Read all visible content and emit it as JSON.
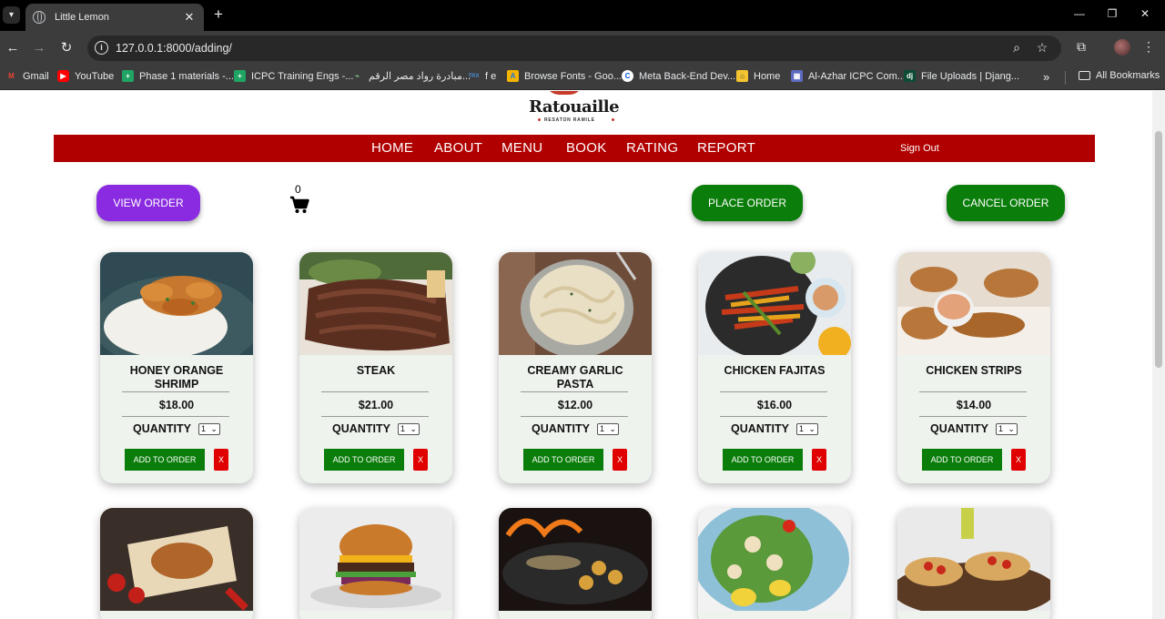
{
  "browser": {
    "tab_title": "Little Lemon",
    "url": "127.0.0.1:8000/adding/",
    "bookmarks": [
      {
        "label": "Gmail",
        "icon": "gmail-icon"
      },
      {
        "label": "YouTube",
        "icon": "youtube-icon"
      },
      {
        "label": "Phase 1 materials -...",
        "icon": "sheets-icon"
      },
      {
        "label": "ICPC Training Engs -...",
        "icon": "sheets-icon"
      },
      {
        "label": "مبادرة رواد مصر الرقم...",
        "icon": "initiative-icon"
      },
      {
        "label": "f e",
        "icon": "fe-icon"
      },
      {
        "label": "Browse Fonts - Goo...",
        "icon": "fonts-icon"
      },
      {
        "label": "Meta Back-End Dev...",
        "icon": "coursera-icon"
      },
      {
        "label": "Home",
        "icon": "home-icon"
      },
      {
        "label": "Al-Azhar ICPC Com...",
        "icon": "community-icon"
      },
      {
        "label": "File Uploads | Djang...",
        "icon": "django-icon"
      }
    ],
    "all_bookmarks": "All Bookmarks"
  },
  "site": {
    "logo_text": "Ratouaille",
    "logo_sub": "RESATON RAMILE",
    "nav": [
      "HOME",
      "ABOUT",
      "MENU",
      "BOOK",
      "RATING",
      "REPORT"
    ],
    "sign_out": "Sign Out",
    "colors": {
      "nav_bg": "#b00000",
      "view_btn": "#8a2be2",
      "green_btn": "#0a7d0a",
      "remove_btn": "#e00000"
    }
  },
  "actions": {
    "view_order": "VIEW ORDER",
    "cart_count": "0",
    "place_order": "PLACE ORDER",
    "cancel_order": "CANCEL ORDER"
  },
  "labels": {
    "quantity": "QUANTITY",
    "add_to_order": "ADD TO ORDER",
    "remove": "X"
  },
  "menu_items": [
    {
      "name": "HONEY ORANGE SHRIMP",
      "price": "$18.00",
      "qty": "1"
    },
    {
      "name": "STEAK",
      "price": "$21.00",
      "qty": "1"
    },
    {
      "name": "CREAMY GARLIC PASTA",
      "price": "$12.00",
      "qty": "1"
    },
    {
      "name": "CHICKEN FAJITAS",
      "price": "$16.00",
      "qty": "1"
    },
    {
      "name": "CHICKEN STRIPS",
      "price": "$14.00",
      "qty": "1"
    }
  ]
}
